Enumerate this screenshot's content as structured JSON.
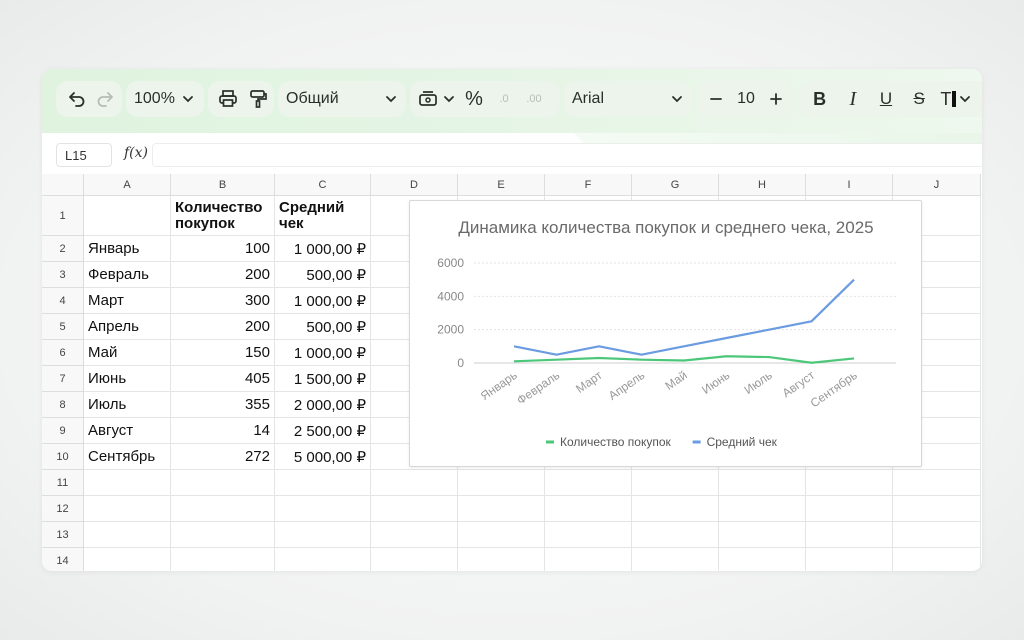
{
  "toolbar": {
    "undo_icon": "undo-icon",
    "redo_icon": "redo-icon",
    "zoom": "100%",
    "number_format": "Общий",
    "percent": "%",
    "decrease_decimals": ".0",
    "increase_decimals": ".00",
    "font_family": "Arial",
    "font_size": "10",
    "bold": "B",
    "italic": "I",
    "underline": "U",
    "strikethrough": "S",
    "text_color": "T"
  },
  "formula_bar": {
    "cell_ref": "L15",
    "fx_label": "f(x)",
    "value": ""
  },
  "columns": [
    "A",
    "B",
    "C",
    "D",
    "E",
    "F",
    "G",
    "H",
    "I",
    "J"
  ],
  "rows": [
    "1",
    "2",
    "3",
    "4",
    "5",
    "6",
    "7",
    "8",
    "9",
    "10",
    "11",
    "12",
    "13",
    "14"
  ],
  "table": {
    "headers": [
      "",
      "Количество покупок",
      "Средний чек"
    ],
    "rows": [
      [
        "Январь",
        "100",
        "1 000,00 ₽"
      ],
      [
        "Февраль",
        "200",
        "500,00 ₽"
      ],
      [
        "Март",
        "300",
        "1 000,00 ₽"
      ],
      [
        "Апрель",
        "200",
        "500,00 ₽"
      ],
      [
        "Май",
        "150",
        "1 000,00 ₽"
      ],
      [
        "Июнь",
        "405",
        "1 500,00 ₽"
      ],
      [
        "Июль",
        "355",
        "2 000,00 ₽"
      ],
      [
        "Август",
        "14",
        "2 500,00 ₽"
      ],
      [
        "Сентябрь",
        "272",
        "5 000,00 ₽"
      ]
    ]
  },
  "colors": {
    "toolbar_bg": "#e2f4e2",
    "series_purchases": "#4cc77a",
    "series_avg_check": "#6b9be0",
    "gridline": "#e3e3e3"
  },
  "chart_data": {
    "type": "line",
    "title": "Динамика количества покупок и среднего чека, 2025",
    "categories": [
      "Январь",
      "Февраль",
      "Март",
      "Апрель",
      "Май",
      "Июнь",
      "Июль",
      "Август",
      "Сентябрь"
    ],
    "series": [
      {
        "name": "Количество покупок",
        "values": [
          100,
          200,
          300,
          200,
          150,
          405,
          355,
          14,
          272
        ]
      },
      {
        "name": "Средний чек",
        "values": [
          1000,
          500,
          1000,
          500,
          1000,
          1500,
          2000,
          2500,
          5000
        ]
      }
    ],
    "yticks": [
      "0",
      "2000",
      "4000",
      "6000"
    ],
    "ylim": [
      0,
      6000
    ],
    "grid": true,
    "legend": "bottom"
  }
}
